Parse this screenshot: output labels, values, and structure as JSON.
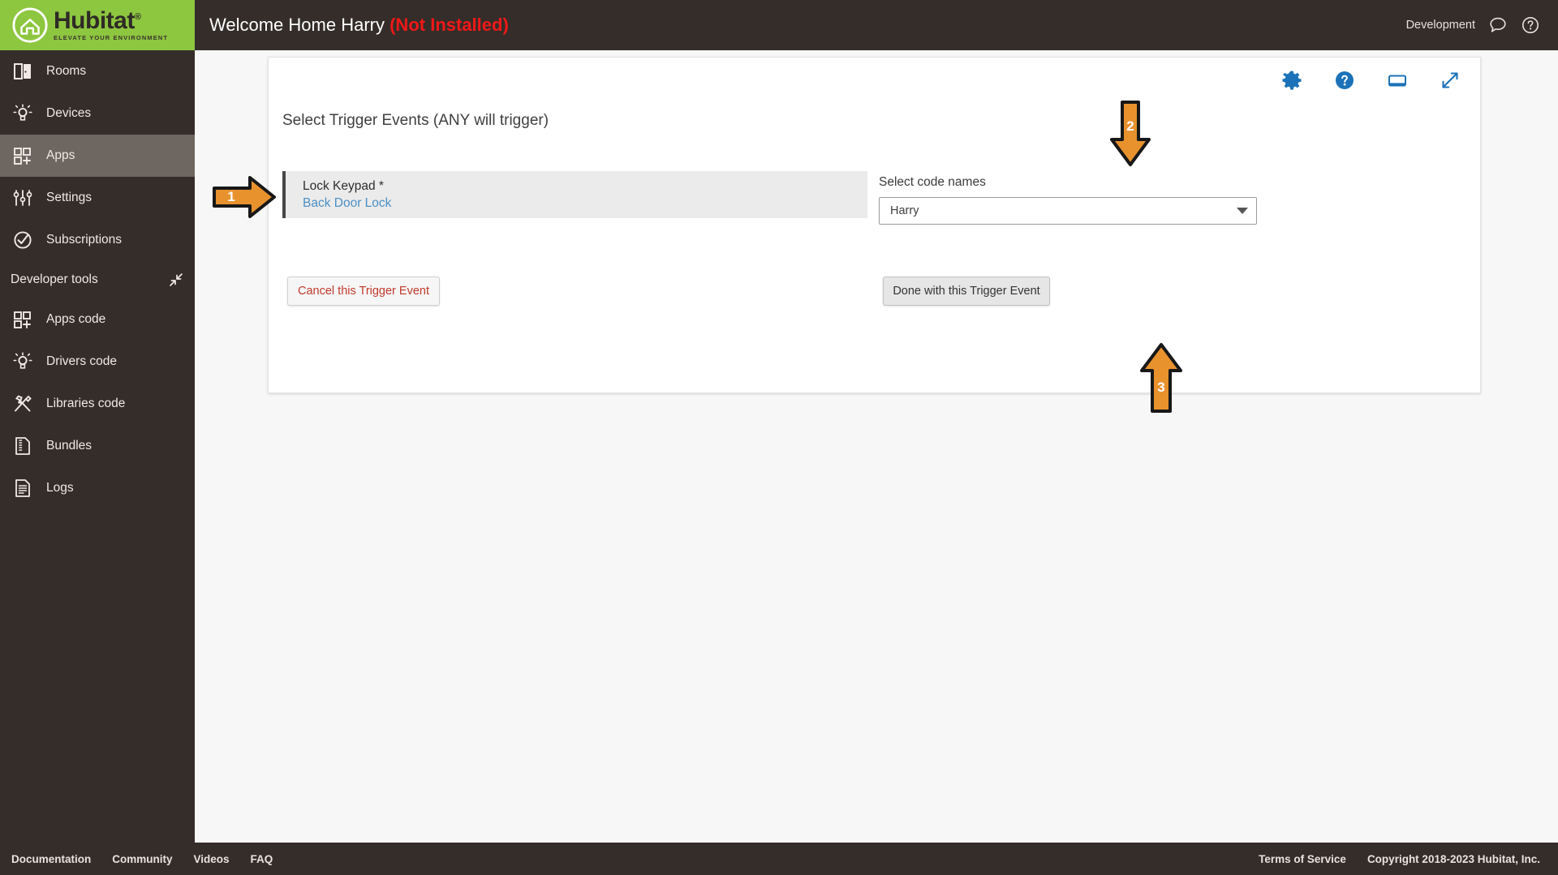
{
  "brand": {
    "name": "Hubitat",
    "registered": "®",
    "tagline": "ELEVATE YOUR ENVIRONMENT",
    "logo_bg": "#8dc63f",
    "chrome_bg": "#342d29"
  },
  "topbar": {
    "title_main": "Welcome Home Harry",
    "title_status": "(Not Installed)",
    "status_color": "#f01818",
    "env_label": "Development",
    "icons": [
      {
        "name": "chat-bubble-icon",
        "glyph": "chat"
      },
      {
        "name": "help-circle-icon",
        "glyph": "help"
      }
    ]
  },
  "sidebar": {
    "items": [
      {
        "label": "Rooms",
        "icon": "rooms-icon",
        "active": false
      },
      {
        "label": "Devices",
        "icon": "devices-icon",
        "active": false
      },
      {
        "label": "Apps",
        "icon": "apps-icon",
        "active": true
      },
      {
        "label": "Settings",
        "icon": "settings-icon",
        "active": false
      },
      {
        "label": "Subscriptions",
        "icon": "subscriptions-icon",
        "active": false
      }
    ],
    "section": {
      "label": "Developer tools",
      "collapse_icon": "collapse-icon"
    },
    "dev_items": [
      {
        "label": "Apps code",
        "icon": "apps-code-icon"
      },
      {
        "label": "Drivers code",
        "icon": "drivers-code-icon"
      },
      {
        "label": "Libraries code",
        "icon": "libraries-code-icon"
      },
      {
        "label": "Bundles",
        "icon": "bundles-icon"
      },
      {
        "label": "Logs",
        "icon": "logs-icon"
      }
    ]
  },
  "card": {
    "icons": [
      {
        "name": "gear-icon"
      },
      {
        "name": "help-circle-icon"
      },
      {
        "name": "display-mode-icon"
      },
      {
        "name": "expand-icon"
      }
    ],
    "accent": "#1b72b8",
    "section_title": "Select Trigger Events (ANY will trigger)",
    "device_field": {
      "label": "Lock Keypad *",
      "value": "Back Door Lock",
      "link_color": "#4b8fc4"
    },
    "code_names": {
      "label": "Select code names",
      "selected": "Harry",
      "options": [
        "Harry"
      ]
    },
    "buttons": {
      "cancel": "Cancel this Trigger Event",
      "done": "Done with this Trigger Event"
    }
  },
  "annotations": {
    "color": "#e8922e",
    "arrows": [
      {
        "number": "1",
        "direction": "right",
        "target": "device-field"
      },
      {
        "number": "2",
        "direction": "down",
        "target": "code-names-select"
      },
      {
        "number": "3",
        "direction": "up",
        "target": "done-button"
      }
    ]
  },
  "footer": {
    "links": [
      "Documentation",
      "Community",
      "Videos",
      "FAQ"
    ],
    "terms": "Terms of Service",
    "copyright": "Copyright 2018-2023 Hubitat, Inc."
  }
}
